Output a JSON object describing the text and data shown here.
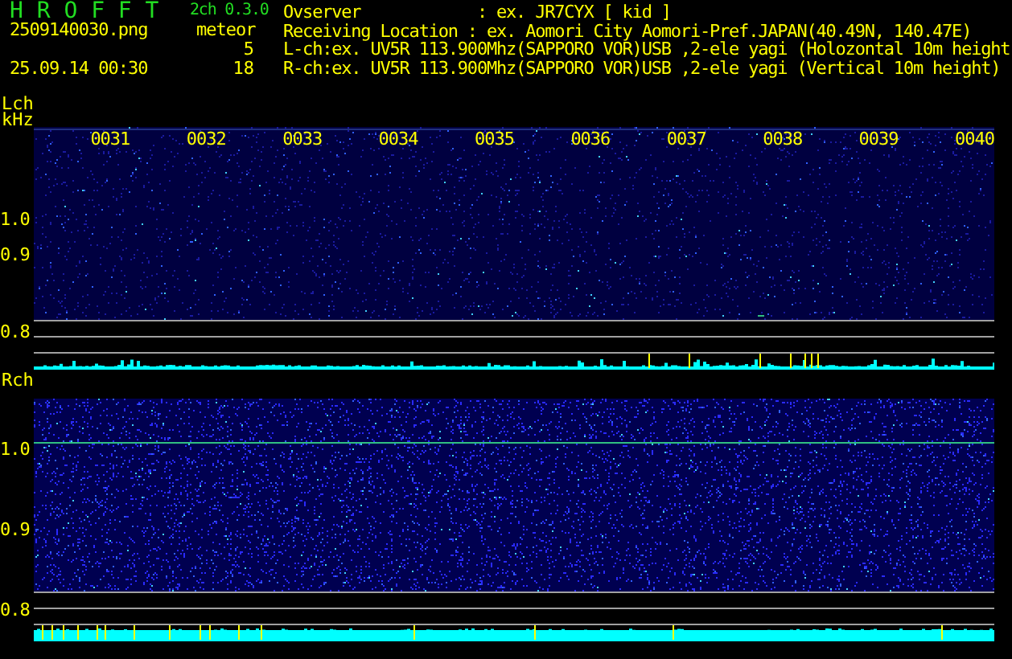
{
  "header": {
    "title": "H R O F F T",
    "version": "2ch 0.3.0",
    "file": "2509140030.png",
    "date": "25.09.14 00:30",
    "meteor_label": "meteor",
    "counts": [
      "5",
      "18"
    ],
    "info": [
      {
        "label": "Ovserver            : ",
        "value": "ex. JR7CYX [ kid ]"
      },
      {
        "label": "Receiving Location : ",
        "value": "ex. Aomori City Aomori-Pref.JAPAN(40.49N, 140.47E)"
      },
      {
        "label": "L-ch:",
        "value": "ex. UV5R 113.900Mhz(SAPPORO VOR)USB ,2-ele yagi (Holozontal 10m height"
      },
      {
        "label": "R-ch:",
        "value": "ex. UV5R 113.900Mhz(SAPPORO VOR)USB ,2-ele yagi (Vertical 10m height)"
      }
    ]
  },
  "channels": [
    {
      "name": "Lch",
      "unit": "kHz",
      "times": [
        "0031",
        "0032",
        "0033",
        "0034",
        "0035",
        "0036",
        "0037",
        "0038",
        "0039",
        "0040"
      ],
      "yticks": [
        "1.0",
        "0.9",
        "0.8"
      ]
    },
    {
      "name": "Rch",
      "yticks": [
        "1.0",
        "0.9",
        "0.8"
      ]
    }
  ]
}
